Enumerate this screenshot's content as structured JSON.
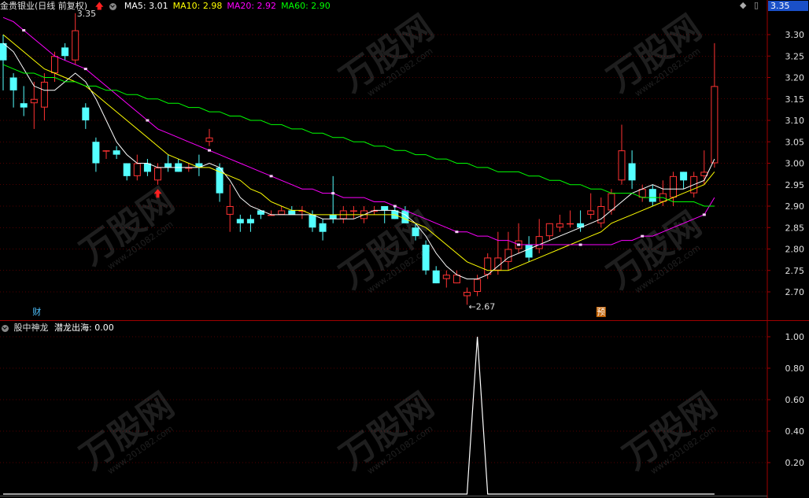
{
  "header": {
    "stock_name": "金贵银业",
    "period": "(日线 前复权)",
    "ma_items": [
      {
        "label": "MA5: 3.01",
        "color": "#ffffff"
      },
      {
        "label": "MA10: 2.98",
        "color": "#ffff00"
      },
      {
        "label": "MA20: 2.92",
        "color": "#ff00ff"
      },
      {
        "label": "MA60: 2.90",
        "color": "#00ff00"
      }
    ],
    "current_price_tag": "3.35"
  },
  "indicator_header": {
    "name": "股中神龙",
    "line_label": "潜龙出海: 0.00",
    "line_color": "#ffffff"
  },
  "chart_data": [
    {
      "type": "candlestick",
      "title": "",
      "ylim": [
        2.65,
        3.35
      ],
      "y_ticks": [
        "3.30",
        "3.25",
        "3.20",
        "3.15",
        "3.10",
        "3.05",
        "3.00",
        "2.95",
        "2.90",
        "2.85",
        "2.80",
        "2.75",
        "2.70"
      ],
      "annotations": [
        {
          "text": "3.35",
          "label": "high"
        },
        {
          "text": "←2.67",
          "label": "low"
        },
        {
          "text": "财",
          "label": "event-marker"
        },
        {
          "text": "预",
          "label": "event-marker"
        }
      ],
      "candles": [
        [
          3.28,
          3.24,
          3.3,
          3.17
        ],
        [
          3.2,
          3.17,
          3.21,
          3.13
        ],
        [
          3.14,
          3.13,
          3.18,
          3.11
        ],
        [
          3.14,
          3.15,
          3.19,
          3.08
        ],
        [
          3.13,
          3.19,
          3.21,
          3.1
        ],
        [
          3.21,
          3.25,
          3.26,
          3.19
        ],
        [
          3.27,
          3.25,
          3.28,
          3.24
        ],
        [
          3.24,
          3.31,
          3.35,
          3.23
        ],
        [
          3.13,
          3.1,
          3.14,
          3.08
        ],
        [
          3.05,
          3.0,
          3.06,
          2.98
        ],
        [
          3.03,
          3.03,
          3.03,
          3.01
        ],
        [
          3.03,
          3.02,
          3.04,
          3.01
        ],
        [
          3.0,
          2.97,
          3.0,
          2.96
        ],
        [
          2.97,
          3.0,
          3.02,
          2.96
        ],
        [
          3.0,
          2.98,
          3.01,
          2.97
        ],
        [
          2.96,
          2.99,
          3.0,
          2.95
        ],
        [
          3.0,
          2.99,
          3.02,
          2.98
        ],
        [
          3.0,
          2.98,
          3.01,
          2.98
        ],
        [
          2.99,
          2.99,
          3.0,
          2.98
        ],
        [
          3.0,
          2.99,
          3.02,
          2.97
        ],
        [
          3.05,
          3.06,
          3.08,
          3.04
        ],
        [
          2.99,
          2.93,
          3.0,
          2.91
        ],
        [
          2.88,
          2.9,
          2.95,
          2.84
        ],
        [
          2.87,
          2.86,
          2.88,
          2.84
        ],
        [
          2.87,
          2.86,
          2.88,
          2.84
        ],
        [
          2.89,
          2.88,
          2.89,
          2.87
        ],
        [
          2.88,
          2.88,
          2.89,
          2.88
        ],
        [
          2.88,
          2.89,
          2.9,
          2.88
        ],
        [
          2.89,
          2.88,
          2.9,
          2.88
        ],
        [
          2.89,
          2.89,
          2.9,
          2.87
        ],
        [
          2.88,
          2.85,
          2.89,
          2.84
        ],
        [
          2.86,
          2.84,
          2.87,
          2.82
        ],
        [
          2.88,
          2.87,
          2.97,
          2.86
        ],
        [
          2.87,
          2.89,
          2.9,
          2.86
        ],
        [
          2.89,
          2.89,
          2.9,
          2.87
        ],
        [
          2.87,
          2.89,
          2.9,
          2.86
        ],
        [
          2.89,
          2.89,
          2.9,
          2.88
        ],
        [
          2.9,
          2.89,
          2.9,
          2.86
        ],
        [
          2.89,
          2.87,
          2.9,
          2.87
        ],
        [
          2.89,
          2.86,
          2.9,
          2.86
        ],
        [
          2.85,
          2.83,
          2.86,
          2.82
        ],
        [
          2.81,
          2.75,
          2.82,
          2.74
        ],
        [
          2.75,
          2.72,
          2.76,
          2.72
        ],
        [
          2.73,
          2.74,
          2.75,
          2.71
        ],
        [
          2.72,
          2.74,
          2.75,
          2.72
        ],
        [
          2.69,
          2.7,
          2.71,
          2.67
        ],
        [
          2.7,
          2.73,
          2.74,
          2.69
        ],
        [
          2.74,
          2.78,
          2.79,
          2.73
        ],
        [
          2.75,
          2.78,
          2.84,
          2.74
        ],
        [
          2.77,
          2.8,
          2.84,
          2.75
        ],
        [
          2.8,
          2.82,
          2.86,
          2.79
        ],
        [
          2.81,
          2.78,
          2.83,
          2.77
        ],
        [
          2.8,
          2.83,
          2.87,
          2.79
        ],
        [
          2.83,
          2.86,
          2.86,
          2.82
        ],
        [
          2.85,
          2.86,
          2.88,
          2.84
        ],
        [
          2.86,
          2.86,
          2.89,
          2.85
        ],
        [
          2.86,
          2.85,
          2.89,
          2.84
        ],
        [
          2.88,
          2.89,
          2.93,
          2.87
        ],
        [
          2.86,
          2.9,
          2.92,
          2.85
        ],
        [
          2.89,
          2.93,
          2.94,
          2.88
        ],
        [
          2.96,
          3.03,
          3.09,
          2.95
        ],
        [
          3.0,
          2.96,
          3.03,
          2.94
        ],
        [
          2.92,
          2.94,
          2.95,
          2.91
        ],
        [
          2.94,
          2.91,
          2.95,
          2.9
        ],
        [
          2.91,
          2.93,
          2.96,
          2.9
        ],
        [
          2.92,
          2.97,
          2.98,
          2.9
        ],
        [
          2.98,
          2.96,
          2.98,
          2.94
        ],
        [
          2.93,
          2.97,
          2.98,
          2.92
        ],
        [
          2.97,
          2.98,
          3.03,
          2.95
        ],
        [
          3.0,
          3.18,
          3.28,
          2.99
        ]
      ],
      "series": [
        {
          "name": "MA5",
          "values": [
            3.28,
            3.26,
            3.22,
            3.18,
            3.17,
            3.17,
            3.19,
            3.21,
            3.19,
            3.15,
            3.1,
            3.05,
            3.02,
            3.0,
            3.0,
            2.99,
            2.99,
            2.99,
            2.99,
            2.99,
            3.0,
            2.99,
            2.96,
            2.92,
            2.9,
            2.89,
            2.88,
            2.88,
            2.88,
            2.88,
            2.88,
            2.87,
            2.87,
            2.87,
            2.87,
            2.88,
            2.89,
            2.89,
            2.89,
            2.88,
            2.86,
            2.83,
            2.79,
            2.76,
            2.74,
            2.73,
            2.73,
            2.74,
            2.76,
            2.78,
            2.79,
            2.8,
            2.81,
            2.82,
            2.83,
            2.84,
            2.85,
            2.86,
            2.87,
            2.89,
            2.91,
            2.93,
            2.94,
            2.95,
            2.94,
            2.94,
            2.94,
            2.95,
            2.96,
            3.01
          ]
        },
        {
          "name": "MA10",
          "values": [
            3.3,
            3.28,
            3.26,
            3.24,
            3.22,
            3.21,
            3.2,
            3.19,
            3.18,
            3.16,
            3.14,
            3.12,
            3.1,
            3.08,
            3.06,
            3.04,
            3.02,
            3.01,
            3.0,
            2.99,
            2.99,
            2.98,
            2.97,
            2.96,
            2.94,
            2.93,
            2.91,
            2.9,
            2.89,
            2.89,
            2.88,
            2.88,
            2.88,
            2.88,
            2.88,
            2.88,
            2.88,
            2.88,
            2.88,
            2.87,
            2.86,
            2.85,
            2.83,
            2.81,
            2.79,
            2.77,
            2.76,
            2.75,
            2.75,
            2.75,
            2.76,
            2.77,
            2.78,
            2.79,
            2.8,
            2.81,
            2.82,
            2.83,
            2.84,
            2.86,
            2.87,
            2.88,
            2.89,
            2.9,
            2.91,
            2.92,
            2.93,
            2.94,
            2.95,
            2.98
          ]
        },
        {
          "name": "MA20",
          "values": [
            3.34,
            3.33,
            3.31,
            3.29,
            3.27,
            3.25,
            3.24,
            3.23,
            3.22,
            3.2,
            3.18,
            3.16,
            3.14,
            3.12,
            3.1,
            3.08,
            3.07,
            3.06,
            3.05,
            3.04,
            3.03,
            3.02,
            3.01,
            3.0,
            2.99,
            2.98,
            2.97,
            2.96,
            2.95,
            2.94,
            2.94,
            2.93,
            2.93,
            2.92,
            2.92,
            2.92,
            2.91,
            2.91,
            2.9,
            2.89,
            2.88,
            2.87,
            2.86,
            2.85,
            2.84,
            2.84,
            2.83,
            2.83,
            2.82,
            2.82,
            2.81,
            2.81,
            2.81,
            2.81,
            2.81,
            2.81,
            2.81,
            2.81,
            2.81,
            2.81,
            2.82,
            2.82,
            2.83,
            2.83,
            2.84,
            2.85,
            2.86,
            2.87,
            2.88,
            2.92
          ]
        },
        {
          "name": "MA60",
          "values": [
            3.23,
            3.22,
            3.21,
            3.21,
            3.2,
            3.2,
            3.19,
            3.19,
            3.18,
            3.18,
            3.17,
            3.17,
            3.16,
            3.16,
            3.15,
            3.15,
            3.14,
            3.14,
            3.13,
            3.13,
            3.12,
            3.12,
            3.11,
            3.11,
            3.1,
            3.1,
            3.09,
            3.09,
            3.08,
            3.08,
            3.07,
            3.07,
            3.06,
            3.06,
            3.05,
            3.05,
            3.04,
            3.04,
            3.03,
            3.03,
            3.02,
            3.02,
            3.01,
            3.01,
            3.0,
            3.0,
            2.99,
            2.99,
            2.98,
            2.98,
            2.98,
            2.97,
            2.97,
            2.96,
            2.96,
            2.95,
            2.95,
            2.94,
            2.94,
            2.93,
            2.93,
            2.93,
            2.92,
            2.92,
            2.92,
            2.91,
            2.91,
            2.91,
            2.9,
            2.9
          ]
        }
      ]
    },
    {
      "type": "line",
      "title": "",
      "ylim": [
        0,
        1.1
      ],
      "y_ticks": [
        "1.00",
        "0.80",
        "0.60",
        "0.40",
        "0.20"
      ],
      "series": [
        {
          "name": "潜龙出海",
          "values": [
            0,
            0,
            0,
            0,
            0,
            0,
            0,
            0,
            0,
            0,
            0,
            0,
            0,
            0,
            0,
            0,
            0,
            0,
            0,
            0,
            0,
            0,
            0,
            0,
            0,
            0,
            0,
            0,
            0,
            0,
            0,
            0,
            0,
            0,
            0,
            0,
            0,
            0,
            0,
            0,
            0,
            0,
            0,
            0,
            0,
            0,
            1,
            0,
            0,
            0,
            0,
            0,
            0,
            0,
            0,
            0,
            0,
            0,
            0,
            0,
            0,
            0,
            0,
            0,
            0,
            0,
            0,
            0,
            0,
            0
          ]
        }
      ]
    }
  ],
  "colors": {
    "up": "#ff3232",
    "down": "#54ffff",
    "grid": "#a00000",
    "axis_text": "#e0e0e0"
  },
  "watermark": {
    "brand": "万股网",
    "url": "www.201082.com"
  }
}
